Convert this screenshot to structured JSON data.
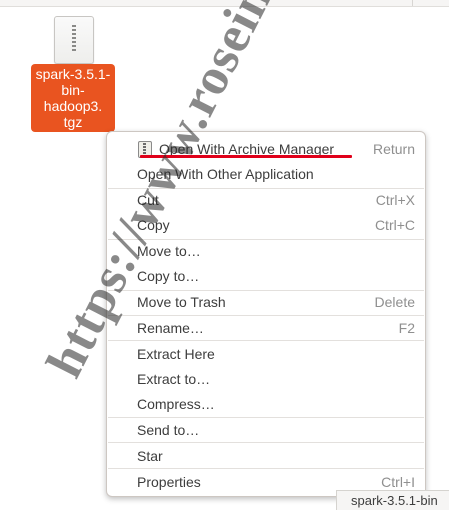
{
  "desktop": {
    "file": {
      "icon": "archive-file-icon",
      "name": "spark-3.5.1-\nbin-\nhadoop3.\ntgz"
    }
  },
  "context_menu": {
    "items": [
      {
        "label": "Open With Archive Manager",
        "accel": "Return",
        "icon": "archive-manager-icon"
      },
      {
        "label": "Open With Other Application",
        "accel": ""
      },
      {
        "label": "Cut",
        "accel": "Ctrl+X"
      },
      {
        "label": "Copy",
        "accel": "Ctrl+C"
      },
      {
        "label": "Move to…",
        "accel": ""
      },
      {
        "label": "Copy to…",
        "accel": ""
      },
      {
        "label": "Move to Trash",
        "accel": "Delete"
      },
      {
        "label": "Rename…",
        "accel": "F2"
      },
      {
        "label": "Extract Here",
        "accel": ""
      },
      {
        "label": "Extract to…",
        "accel": ""
      },
      {
        "label": "Compress…",
        "accel": ""
      },
      {
        "label": "Send to…",
        "accel": ""
      },
      {
        "label": "Star",
        "accel": ""
      },
      {
        "label": "Properties",
        "accel": "Ctrl+I"
      }
    ],
    "highlight_color": "#e0001a"
  },
  "watermark": "https://www.roseindia.net",
  "status_bar": {
    "selected_name": "spark-3.5.1-bin"
  },
  "colors": {
    "selection": "#e95420"
  }
}
